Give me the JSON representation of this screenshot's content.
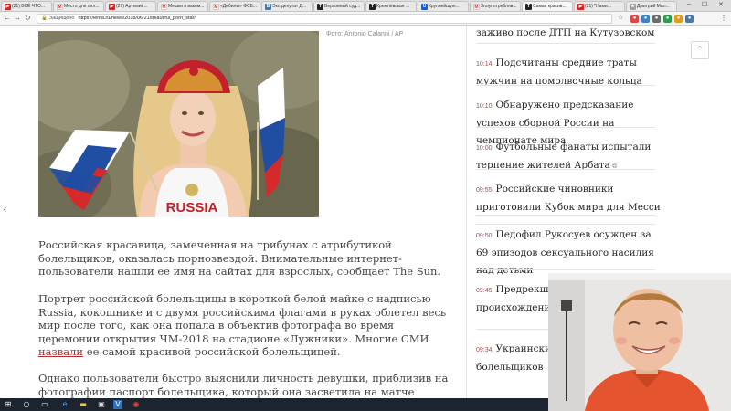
{
  "browser": {
    "tabs": [
      {
        "label": "(21) ВСЁ ЧТО...",
        "icon": "youtube-icon"
      },
      {
        "label": "Место для опл...",
        "icon": "gmail-icon"
      },
      {
        "label": "(21) Артемий...",
        "icon": "youtube-icon"
      },
      {
        "label": "Мешки в ваком...",
        "icon": "gmail-icon"
      },
      {
        "label": "«Дебилы» ФСБ...",
        "icon": "gmail-icon"
      },
      {
        "label": "Экс-депутат Д...",
        "icon": "vk-icon"
      },
      {
        "label": "Верховный суд...",
        "icon": "lenta-icon"
      },
      {
        "label": "Кремлёвская ...",
        "icon": "lenta-icon"
      },
      {
        "label": "Крупнейшую...",
        "icon": "udp-icon"
      },
      {
        "label": "Злоупотребляв...",
        "icon": "gmail-icon"
      },
      {
        "label": "Самая красив...",
        "icon": "lenta-icon",
        "active": true
      },
      {
        "label": "(21) \"Нами...",
        "icon": "youtube-icon"
      },
      {
        "label": "Дмитрий Мал...",
        "icon": "bookmark-icon"
      }
    ],
    "secure_label": "Защищено",
    "url": "https://lenta.ru/news/2018/06/21/beautiful_porn_star/"
  },
  "article": {
    "photo_credit": "Фото: Antonio Calanni / AP",
    "shirt_text": "RUSSIA",
    "p1": "Российская красавица, замеченная на трибунах с атрибутикой болельщиков, оказалась порнозвездой. Внимательные интернет-пользователи нашли ее имя на сайтах для взрослых, сообщает The Sun.",
    "p2_before": "Портрет российской болельщицы в короткой белой майке с надписью Russia, кокошнике и с двумя российскими флагами в руках облетел весь мир после того, как она попала в объектив фотографа во время церемонии открытия ЧМ-2018 на стадионе «Лужники». Многие СМИ ",
    "p2_link": "назвали",
    "p2_after": " ее самой красивой российской болельщицей.",
    "p3": "Однако пользователи быстро выяснили личность девушки, приблизив на фотографии паспорт болельщика, который она засветила на матче между"
  },
  "sidebar": {
    "top_fragment": "заживо после ДТП на Кутузовском",
    "items": [
      {
        "time": "10:14",
        "title": "Подсчитаны средние траты мужчин на помолвочные кольца",
        "external": false
      },
      {
        "time": "10:10",
        "title": "Обнаружено предсказание успехов сборной России на чемпионате мира",
        "external": false
      },
      {
        "time": "10:00",
        "title": "Футбольные фанаты испытали терпение жителей Арбата",
        "external": true
      },
      {
        "time": "09:55",
        "title": "Российские чиновники приготовили Кубок мира для Месси",
        "external": false
      },
      {
        "time": "09:50",
        "title": "Педофил Рукосуев осужден за 69 эпизодов сексуального насилия над детьми",
        "external": false
      },
      {
        "time": "09:45",
        "title": "Предрекше Кикабидзе напо происхождени",
        "external": false
      },
      {
        "time": "09:34",
        "title": "Украинский посмеялся над « болельщиков",
        "external": false
      }
    ]
  },
  "colors": {
    "accent": "#c04040",
    "link": "#b32e2e"
  }
}
